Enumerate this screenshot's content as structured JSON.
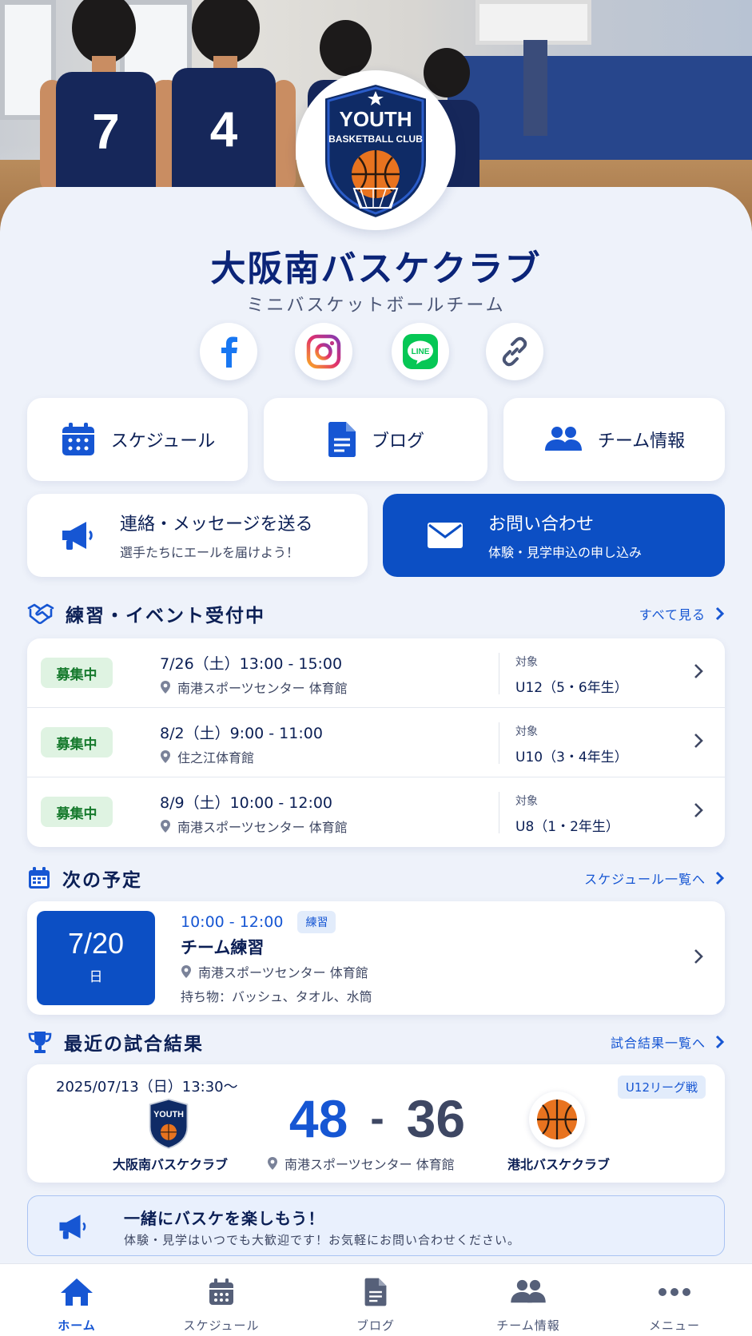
{
  "hero": {
    "jersey_numbers": [
      "7",
      "4"
    ]
  },
  "logo": {
    "text_line1": "YOUTH",
    "text_line2": "BASKETBALL CLUB"
  },
  "club": {
    "name": "大阪南バスケクラブ",
    "tagline": "ミニバスケットボールチーム"
  },
  "social": [
    {
      "icon": "facebook-icon"
    },
    {
      "icon": "instagram-icon"
    },
    {
      "icon": "line-icon",
      "text": "LINE"
    },
    {
      "icon": "link-icon"
    }
  ],
  "nav_cards": [
    {
      "label": "スケジュール",
      "icon": "calendar-icon"
    },
    {
      "label": "ブログ",
      "icon": "document-icon"
    },
    {
      "label": "チーム情報",
      "icon": "team-icon"
    }
  ],
  "message": {
    "title": "連絡・メッセージを送る",
    "subtitle": "選手たちにエールを届けよう！"
  },
  "contact": {
    "title": "お問い合わせ",
    "subtitle": "体験・見学申込の申し込み"
  },
  "events": {
    "heading": "練習・イベント受付中",
    "more": "すべて見る",
    "items": [
      {
        "badge": "募集中",
        "date": "7/26（土）13:00 - 15:00",
        "place": "南港スポーツセンター 体育館",
        "target_label": "対象",
        "target": "U12（5・6年生）"
      },
      {
        "badge": "募集中",
        "date": "8/2（土）9:00 - 11:00",
        "place": "住之江体育館",
        "target_label": "対象",
        "target": "U10（3・4年生）"
      },
      {
        "badge": "募集中",
        "date": "8/9（土）10:00 - 12:00",
        "place": "南港スポーツセンター 体育館",
        "target_label": "対象",
        "target": "U8（1・2年生）"
      }
    ]
  },
  "next": {
    "heading": "次の予定",
    "more": "スケジュール一覧へ",
    "date": "7/20",
    "weekday": "日",
    "time": "10:00 - 12:00",
    "tag": "練習",
    "title": "チーム練習",
    "place": "南港スポーツセンター 体育館",
    "items": "持ち物：バッシュ、タオル、水筒"
  },
  "results": {
    "heading": "最近の試合結果",
    "more": "試合結果一覧へ",
    "datetime": "2025/07/13（日）13:30〜",
    "league": "U12リーグ戦",
    "home_team": "大阪南バスケクラブ",
    "away_team": "港北バスケクラブ",
    "home_score": "48",
    "separator": "-",
    "away_score": "36",
    "place": "南港スポーツセンター 体育館"
  },
  "banner": {
    "title": "一緒にバスケを楽しもう！",
    "text": "体験・見学はいつでも大歓迎です！お気軽にお問い合わせください。"
  },
  "bottom_nav": [
    {
      "label": "ホーム",
      "icon": "home-icon",
      "active": true
    },
    {
      "label": "スケジュール",
      "icon": "calendar-icon"
    },
    {
      "label": "ブログ",
      "icon": "document-icon"
    },
    {
      "label": "チーム情報",
      "icon": "team-icon"
    },
    {
      "label": "メニュー",
      "icon": "more-icon"
    }
  ],
  "colors": {
    "primary": "#0c4fc4",
    "navy": "#0b1f55",
    "accent_link": "#1656d3",
    "open_badge_bg": "#dff3e2",
    "open_badge_text": "#167a2d",
    "background": "#eef2fa"
  }
}
